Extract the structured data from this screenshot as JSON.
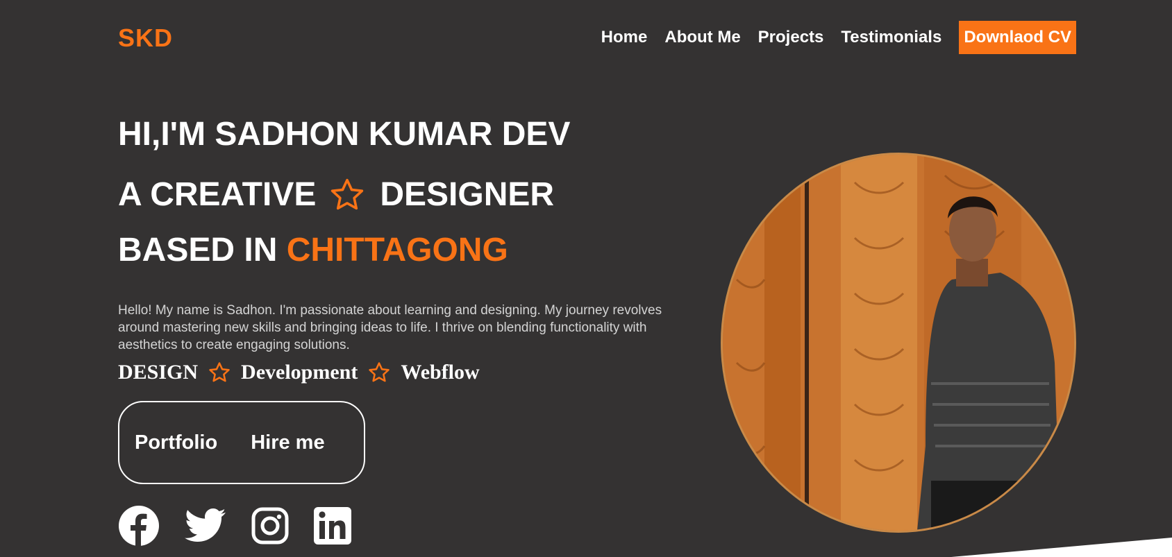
{
  "header": {
    "logo": "SKD",
    "nav": [
      "Home",
      "About Me",
      "Projects",
      "Testimonials"
    ],
    "cv_button": "Downlaod CV"
  },
  "hero": {
    "line1": "HI,I'M SADHON KUMAR DEV",
    "line2_before": "A CREATIVE",
    "line2_after": "DESIGNER",
    "line3_before": "BASED IN",
    "line3_highlight": "CHITTAGONG",
    "intro": "Hello! My name is Sadhon. I'm passionate about learning and designing. My journey revolves around mastering new skills and bringing ideas to life. I thrive on blending functionality with aesthetics to create engaging solutions.",
    "skills": [
      "DESIGN",
      "Development",
      "Webflow"
    ]
  },
  "cta": {
    "portfolio": "Portfolio",
    "hire": "Hire me"
  },
  "social": [
    "facebook-icon",
    "twitter-icon",
    "instagram-icon",
    "linkedin-icon"
  ],
  "colors": {
    "background": "#343232",
    "accent": "#f97316",
    "text": "#ffffff"
  }
}
